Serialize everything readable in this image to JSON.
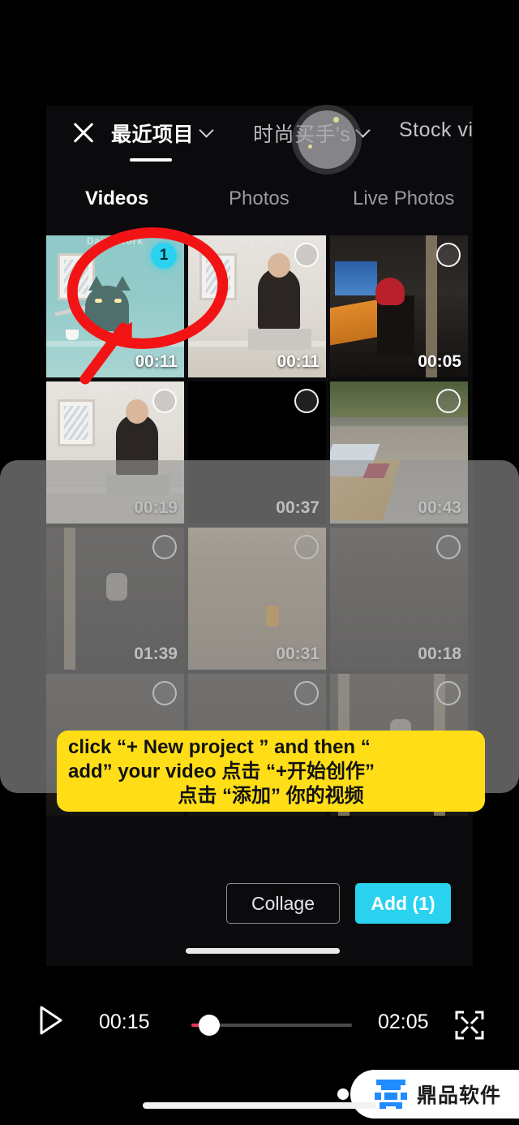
{
  "header": {
    "close_label": "×",
    "tabs": [
      {
        "label": "最近项目",
        "active": true
      },
      {
        "label": "时尚买手's",
        "active": false
      },
      {
        "label": "Stock vid",
        "active": false
      }
    ]
  },
  "media_tabs": [
    {
      "label": "Videos",
      "active": true
    },
    {
      "label": "Photos",
      "active": false
    },
    {
      "label": "Live Photos",
      "active": false
    }
  ],
  "grid": {
    "banner_text": "Daily work",
    "items": [
      {
        "duration": "00:11",
        "selected": true,
        "badge": "1",
        "art": "cat"
      },
      {
        "duration": "00:11",
        "selected": false,
        "badge": "",
        "art": "desk"
      },
      {
        "duration": "00:05",
        "selected": false,
        "badge": "",
        "art": "garage"
      },
      {
        "duration": "00:19",
        "selected": false,
        "badge": "",
        "art": "desk"
      },
      {
        "duration": "00:37",
        "selected": false,
        "badge": "",
        "art": "black"
      },
      {
        "duration": "00:43",
        "selected": false,
        "badge": "",
        "art": "road"
      },
      {
        "duration": "01:39",
        "selected": false,
        "badge": "",
        "art": "dark1"
      },
      {
        "duration": "00:31",
        "selected": false,
        "badge": "",
        "art": "sand"
      },
      {
        "duration": "00:18",
        "selected": false,
        "badge": "",
        "art": "dim"
      },
      {
        "duration": "",
        "selected": false,
        "badge": "",
        "art": "dim"
      },
      {
        "duration": "",
        "selected": false,
        "badge": "",
        "art": "dim"
      },
      {
        "duration": "",
        "selected": false,
        "badge": "",
        "art": "door"
      }
    ]
  },
  "tooltip": {
    "line1": "click  “+ New project ”  and then   “",
    "line2": "add”  your video 点击 “+开始创作”",
    "line3": "点击 “添加” 你的视频",
    "color": "#ffde17"
  },
  "actions": {
    "collage_label": "Collage",
    "add_label": "Add (1)",
    "add_color": "#2ad2f0"
  },
  "player": {
    "current_time": "00:15",
    "total_time": "02:05",
    "progress_percent": 7,
    "accent_color": "#e8344e"
  },
  "watermark": {
    "text": "鼎品软件",
    "logo_color": "#1f8cff"
  },
  "annotation": {
    "color": "#f21414",
    "shapes": "circle-highlight-and-arrow"
  }
}
